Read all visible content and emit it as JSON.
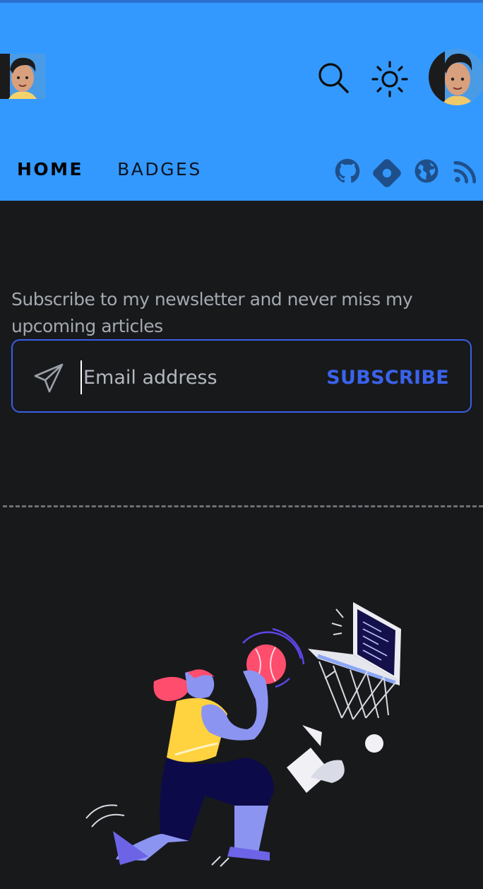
{
  "header": {
    "logo_alt": "Blog logo avatar",
    "avatar_alt": "Profile avatar",
    "background": "#3399ff"
  },
  "nav": {
    "items": [
      {
        "label": "HOME",
        "active": true
      },
      {
        "label": "BADGES",
        "active": false
      }
    ]
  },
  "social": {
    "icons": [
      "github-icon",
      "hashnode-icon",
      "website-icon",
      "rss-icon"
    ]
  },
  "newsletter": {
    "text": "Subscribe to my newsletter and never miss my upcoming articles",
    "email_placeholder": "Email address",
    "email_value": "",
    "subscribe_label": "SUBSCRIBE",
    "accent": "#3a63ec"
  },
  "illustration": {
    "icon": "basketball-player-illustration"
  }
}
